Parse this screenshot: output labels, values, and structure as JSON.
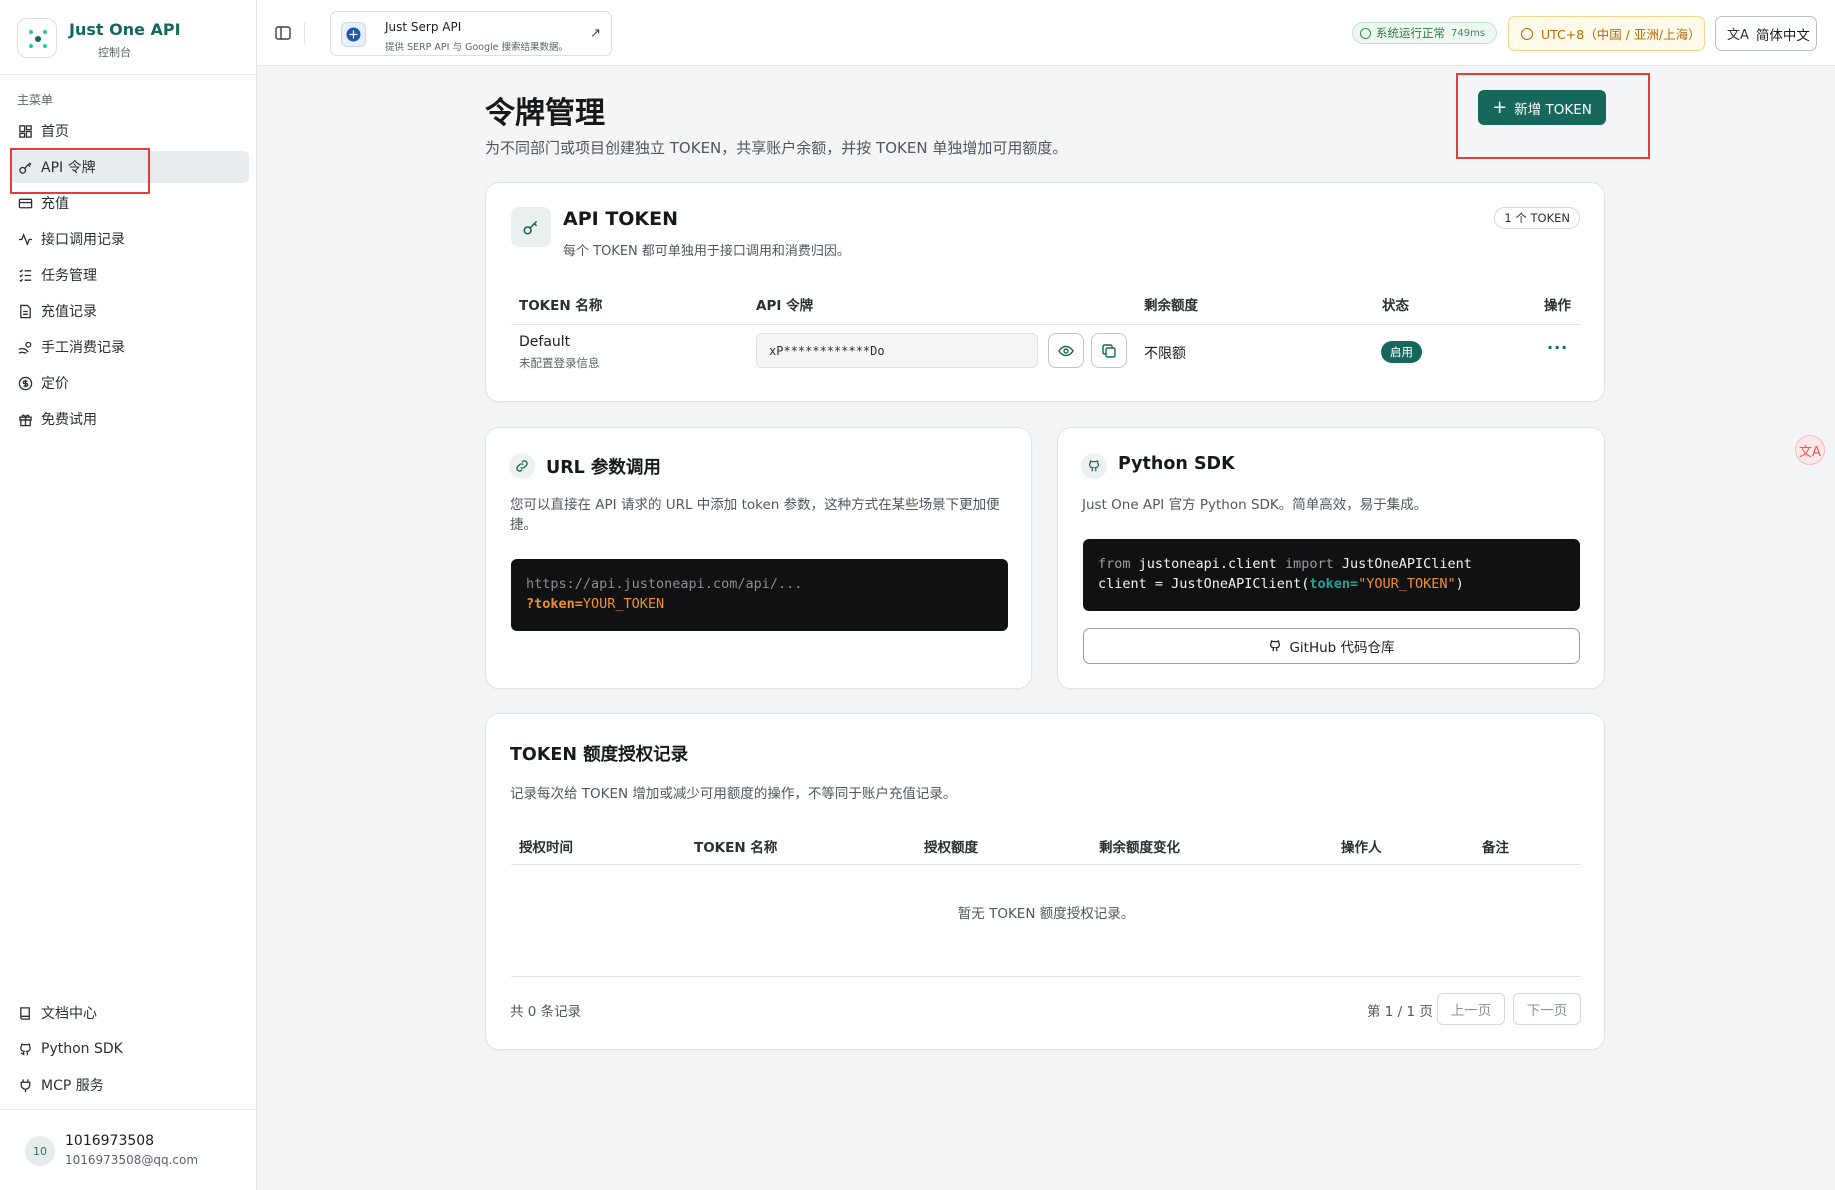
{
  "brand": {
    "title": "Just One API",
    "subtitle": "控制台"
  },
  "sidebar": {
    "heading": "主菜单",
    "items": [
      {
        "label": "首页",
        "icon": "dashboard-icon"
      },
      {
        "label": "API 令牌",
        "icon": "key-icon",
        "active": true
      },
      {
        "label": "充值",
        "icon": "card-icon"
      },
      {
        "label": "接口调用记录",
        "icon": "activity-icon"
      },
      {
        "label": "任务管理",
        "icon": "checklist-icon"
      },
      {
        "label": "充值记录",
        "icon": "document-icon"
      },
      {
        "label": "手工消费记录",
        "icon": "hand-coins-icon"
      },
      {
        "label": "定价",
        "icon": "dollar-icon"
      },
      {
        "label": "免费试用",
        "icon": "gift-icon"
      }
    ],
    "footer_items": [
      {
        "label": "文档中心",
        "icon": "book-icon"
      },
      {
        "label": "Python SDK",
        "icon": "github-icon"
      },
      {
        "label": "MCP 服务",
        "icon": "plug-icon"
      }
    ],
    "user": {
      "avatar": "10",
      "name": "1016973508",
      "email": "1016973508@qq.com"
    }
  },
  "header": {
    "serp": {
      "title": "Just Serp API",
      "subtitle": "提供 SERP API 与 Google 搜索结果数据。"
    },
    "status": {
      "label": "系统运行正常",
      "latency": "749ms"
    },
    "timezone": "UTC+8（中国 / 亚洲/上海）",
    "language": "简体中文"
  },
  "page": {
    "title": "令牌管理",
    "description": "为不同部门或项目创建独立 TOKEN，共享账户余额，并按 TOKEN 单独增加可用额度。",
    "new_token_label": "新增 TOKEN"
  },
  "token_card": {
    "title": "API TOKEN",
    "description": "每个 TOKEN 都可单独用于接口调用和消费归因。",
    "count": "1 个 TOKEN",
    "columns": [
      "TOKEN 名称",
      "API 令牌",
      "剩余额度",
      "状态",
      "操作"
    ],
    "rows": [
      {
        "name": "Default",
        "sub": "未配置登录信息",
        "key": "xP************Do",
        "quota": "不限额",
        "status": "启用",
        "action": "···"
      }
    ]
  },
  "url_card": {
    "title": "URL 参数调用",
    "description": "您可以直接在 API 请求的 URL 中添加 token 参数，这种方式在某些场景下更加便捷。",
    "code_line1": "https://api.justoneapi.com/api/...",
    "code_param": "?token=",
    "code_value": "YOUR_TOKEN"
  },
  "sdk_card": {
    "title": "Python SDK",
    "description": "Just One API 官方 Python SDK。简单高效，易于集成。",
    "code_from": "from",
    "code_module": " justoneapi.client ",
    "code_import": "import",
    "code_class": " JustOneAPIClient",
    "code_line2_a": "client = JustOneAPIClient(",
    "code_line2_kw": "token=",
    "code_line2_str": "\"YOUR_TOKEN\"",
    "code_line2_end": ")",
    "github_label": "GitHub 代码仓库"
  },
  "record_card": {
    "title": "TOKEN 额度授权记录",
    "description": "记录每次给 TOKEN 增加或减少可用额度的操作，不等同于账户充值记录。",
    "columns": [
      "授权时间",
      "TOKEN 名称",
      "授权额度",
      "剩余额度变化",
      "操作人",
      "备注"
    ],
    "empty": "暂无 TOKEN 额度授权记录。",
    "total": "共 0 条记录",
    "page_info": "第 1 / 1 页",
    "prev": "上一页",
    "next": "下一页"
  },
  "translate_fab": "文A",
  "colors": {
    "brand": "#17685c",
    "highlight": "#e23c3c"
  }
}
